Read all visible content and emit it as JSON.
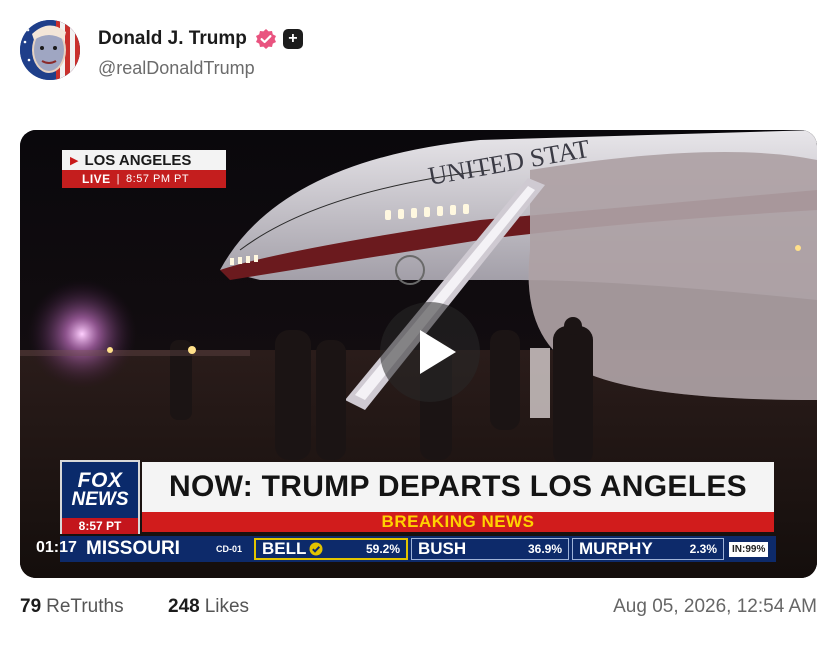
{
  "post": {
    "author_name": "Donald J. Trump",
    "handle": "@realDonaldTrump",
    "retruths_count": "79",
    "retruths_label": "ReTruths",
    "likes_count": "248",
    "likes_label": "Likes",
    "timestamp": "Aug 05, 2026, 12:54 AM"
  },
  "video": {
    "timecode": "01:17",
    "location_label": "LOS ANGELES",
    "live_label": "LIVE",
    "live_time": "8:57 PM PT",
    "plane_text": "UNITED STAT",
    "network_line1": "FOX",
    "network_line2": "NEWS",
    "network_time": "8:57 PT",
    "headline": "NOW: TRUMP DEPARTS LOS ANGELES",
    "breaking": "BREAKING NEWS",
    "ticker": {
      "state": "MISSOURI",
      "district": "CD-01",
      "candidates": [
        {
          "name": "BELL",
          "pct": "59.2%"
        },
        {
          "name": "BUSH",
          "pct": "36.9%"
        },
        {
          "name": "MURPHY",
          "pct": "2.3%"
        }
      ],
      "reporting": "IN:99%"
    }
  },
  "icons": {
    "verified": "verified-badge-icon",
    "plus": "plus-badge-icon",
    "play": "play-icon",
    "check": "check-icon"
  },
  "colors": {
    "verified_badge": "#e9537f",
    "fox_blue": "#0a2a6b",
    "breaking_red": "#d11c1c",
    "breaking_text": "#ffd200"
  }
}
